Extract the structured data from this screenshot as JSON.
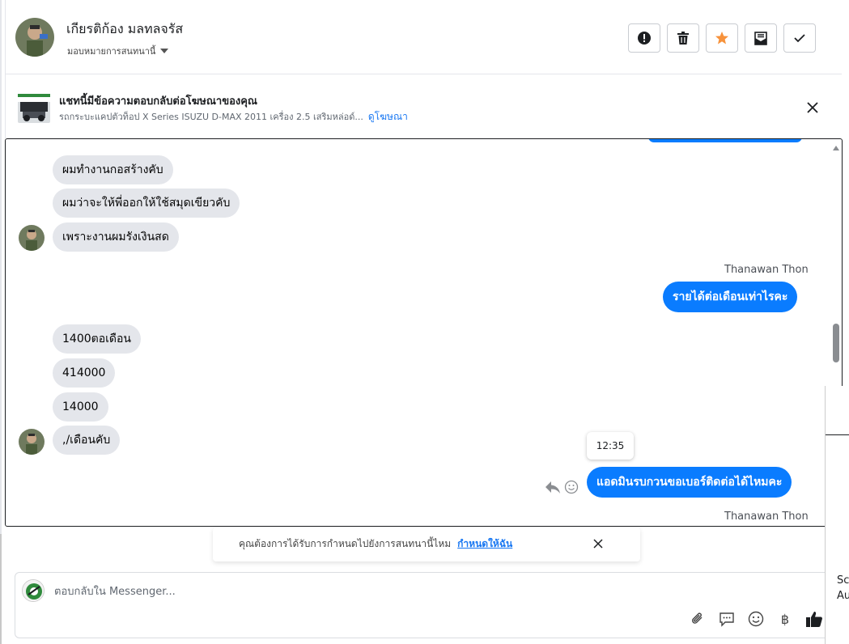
{
  "header": {
    "contact_name": "เกียรติก้อง มลทลจรัส",
    "assign_label": "มอบหมายการสนทนานี้",
    "tools": [
      {
        "name": "mark-spam-button",
        "icon": "alert-circle-icon"
      },
      {
        "name": "delete-button",
        "icon": "trash-icon"
      },
      {
        "name": "star-button",
        "icon": "star-icon"
      },
      {
        "name": "mark-unread-button",
        "icon": "envelope-icon"
      },
      {
        "name": "done-button",
        "icon": "check-icon"
      }
    ]
  },
  "ad_banner": {
    "title": "แชทนี้มีข้อความตอบกลับต่อโฆษณาของคุณ",
    "subtitle": "รถกระบะแคปตัวท็อป X Series ISUZU D-MAX 2011 เครื่อง 2.5 เสริมหล่อด์...",
    "link": "ดูโฆษณา"
  },
  "messages": {
    "in_1": "ผมทำงานกอสร้างคับ",
    "in_2": "ผมว่าจะให้พี่ออกให้ใช้สมุดเขียวคับ",
    "in_3": "เพราะงานผมรังเงินสด",
    "sender_1": "Thanawan Thon",
    "out_1": "รายได้ต่อเดือนเท่าไรคะ",
    "in_4": "1400ตอเดือน",
    "in_5": "414000",
    "in_6": "14000",
    "in_7": ",/เดือนคับ",
    "tooltip_time": "12:35",
    "out_2": "แอดมินรบกวนขอเบอร์ติดต่อได้ไหมคะ",
    "sender_2": "Thanawan Thon"
  },
  "notice": {
    "text": "คุณต้องการได้รับการกำหนดไปยังการสนทนานี้ไหม",
    "link": "กำหนดให้ฉัน"
  },
  "composer": {
    "placeholder": "ตอบกลับใน Messenger...",
    "tools": [
      "attach-icon",
      "saved-reply-icon",
      "emoji-icon",
      "baht-icon",
      "like-icon"
    ]
  },
  "side_panel": {
    "line1": "Sc",
    "line2": "Au"
  },
  "colors": {
    "outgoing_bubble": "#0a7cff",
    "incoming_bubble": "#e4e6eb",
    "link": "#1877f2",
    "star": "#f7923b"
  }
}
